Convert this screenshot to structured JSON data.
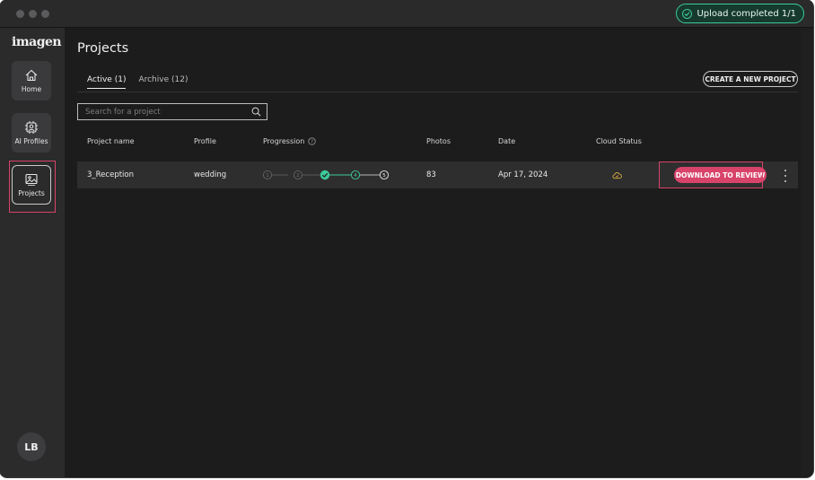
{
  "toast": {
    "text": "Upload completed 1/1",
    "icon": "check-circle-icon",
    "accent": "#3dc99a"
  },
  "app": {
    "logo": "imagen"
  },
  "sidebar": {
    "items": [
      {
        "label": "Home",
        "icon": "home-icon"
      },
      {
        "label": "AI Profiles",
        "icon": "ai-profile-icon"
      },
      {
        "label": "Projects",
        "icon": "photo-icon",
        "active": true
      }
    ],
    "avatar": "LB"
  },
  "page": {
    "title": "Projects"
  },
  "tabs": [
    {
      "label": "Active (1)",
      "active": true
    },
    {
      "label": "Archive (12)",
      "active": false
    }
  ],
  "create_button": "CREATE A NEW PROJECT",
  "search": {
    "placeholder": "Search for a project",
    "value": ""
  },
  "table": {
    "columns": [
      "Project name",
      "Profile",
      "Progression",
      "Photos",
      "Date",
      "Cloud Status"
    ],
    "rows": [
      {
        "project_name": "3_Reception",
        "profile": "wedding",
        "progression_steps": [
          "1",
          "2",
          "✓",
          "4",
          "5"
        ],
        "progression_completed_step": 3,
        "photos": "83",
        "date": "Apr 17, 2024",
        "cloud_status_icon": "cloud-check-icon",
        "action": "DOWNLOAD TO REVIEW"
      }
    ]
  },
  "colors": {
    "accent_pink": "#d8436a",
    "accent_green": "#3dc99a",
    "cloud_yellow": "#e2b340"
  }
}
